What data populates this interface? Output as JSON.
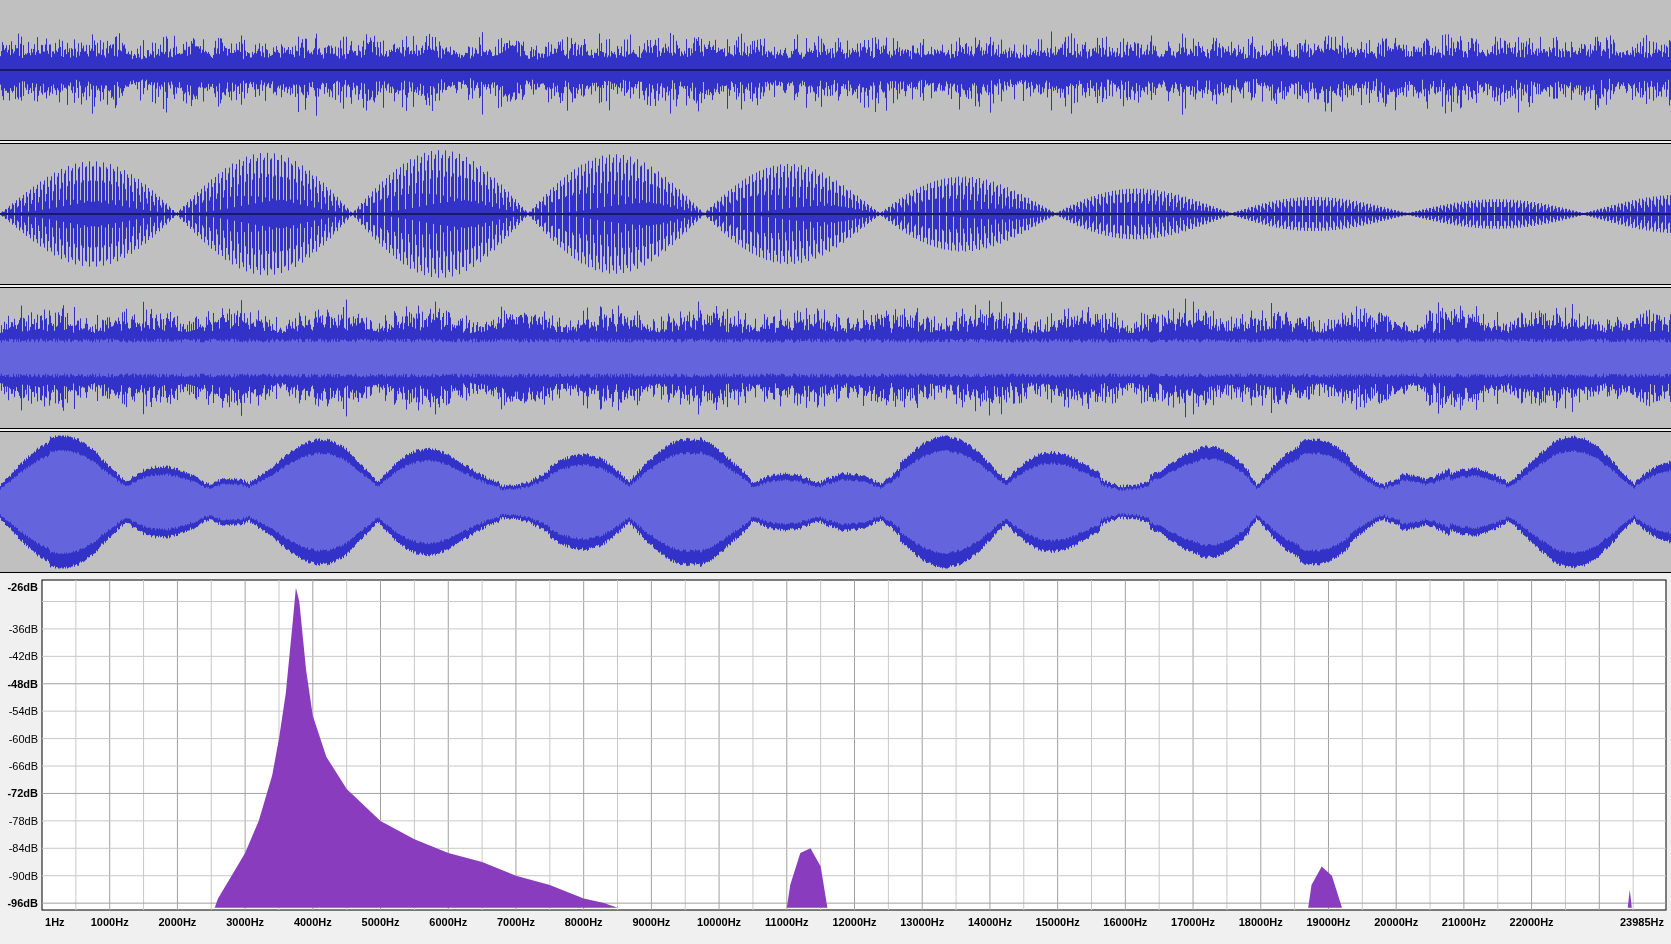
{
  "tracks": [
    {
      "kind": "sparse-noise"
    },
    {
      "kind": "beating-tone"
    },
    {
      "kind": "dense-noise"
    },
    {
      "kind": "modulated-noise"
    }
  ],
  "spectrum": {
    "chart_data": {
      "type": "area",
      "grid": true,
      "xlim": [
        0,
        23985
      ],
      "ylim": [
        -97.5,
        -25.3
      ],
      "x": [
        2550,
        2600,
        2800,
        3000,
        3200,
        3400,
        3500,
        3600,
        3700,
        3750,
        3800,
        3900,
        4000,
        4200,
        4500,
        5000,
        5500,
        6000,
        6500,
        7000,
        7500,
        8000,
        8300,
        8500,
        9500,
        11000,
        11050,
        11200,
        11350,
        11500,
        11600,
        15000,
        18700,
        18750,
        18900,
        19050,
        19200,
        21000,
        23420,
        23450,
        23480
      ],
      "series": [
        {
          "color": "#8a3cbf",
          "values": [
            -97,
            -95,
            -90,
            -85,
            -78,
            -68,
            -60,
            -50,
            -35,
            -27,
            -30,
            -45,
            -55,
            -64,
            -71,
            -78,
            -82,
            -85,
            -87,
            -90,
            -92,
            -95,
            -96,
            -97,
            null,
            -97,
            -92,
            -85,
            -84,
            -88,
            -97,
            null,
            -97,
            -92,
            -88,
            -90,
            -97,
            null,
            -97,
            -93,
            -97
          ]
        }
      ],
      "xticks": [
        {
          "value": 1,
          "label": "1Hz"
        },
        {
          "value": 1000,
          "label": "1000Hz"
        },
        {
          "value": 2000,
          "label": "2000Hz"
        },
        {
          "value": 3000,
          "label": "3000Hz"
        },
        {
          "value": 4000,
          "label": "4000Hz"
        },
        {
          "value": 5000,
          "label": "5000Hz"
        },
        {
          "value": 6000,
          "label": "6000Hz"
        },
        {
          "value": 7000,
          "label": "7000Hz"
        },
        {
          "value": 8000,
          "label": "8000Hz"
        },
        {
          "value": 9000,
          "label": "9000Hz"
        },
        {
          "value": 10000,
          "label": "10000Hz"
        },
        {
          "value": 11000,
          "label": "11000Hz"
        },
        {
          "value": 12000,
          "label": "12000Hz"
        },
        {
          "value": 13000,
          "label": "13000Hz"
        },
        {
          "value": 14000,
          "label": "14000Hz"
        },
        {
          "value": 15000,
          "label": "15000Hz"
        },
        {
          "value": 16000,
          "label": "16000Hz"
        },
        {
          "value": 17000,
          "label": "17000Hz"
        },
        {
          "value": 18000,
          "label": "18000Hz"
        },
        {
          "value": 19000,
          "label": "19000Hz"
        },
        {
          "value": 20000,
          "label": "20000Hz"
        },
        {
          "value": 21000,
          "label": "21000Hz"
        },
        {
          "value": 22000,
          "label": "22000Hz"
        },
        {
          "value": 23985,
          "label": "23985Hz"
        }
      ],
      "yticks": [
        {
          "value": -26,
          "label": "-26dB"
        },
        {
          "value": -36,
          "label": "-36dB"
        },
        {
          "value": -42,
          "label": "-42dB"
        },
        {
          "value": -48,
          "label": "-48dB"
        },
        {
          "value": -54,
          "label": "-54dB"
        },
        {
          "value": -60,
          "label": "-60dB"
        },
        {
          "value": -66,
          "label": "-66dB"
        },
        {
          "value": -72,
          "label": "-72dB"
        },
        {
          "value": -78,
          "label": "-78dB"
        },
        {
          "value": -84,
          "label": "-84dB"
        },
        {
          "value": -90,
          "label": "-90dB"
        },
        {
          "value": -96,
          "label": "-96dB"
        }
      ]
    }
  }
}
